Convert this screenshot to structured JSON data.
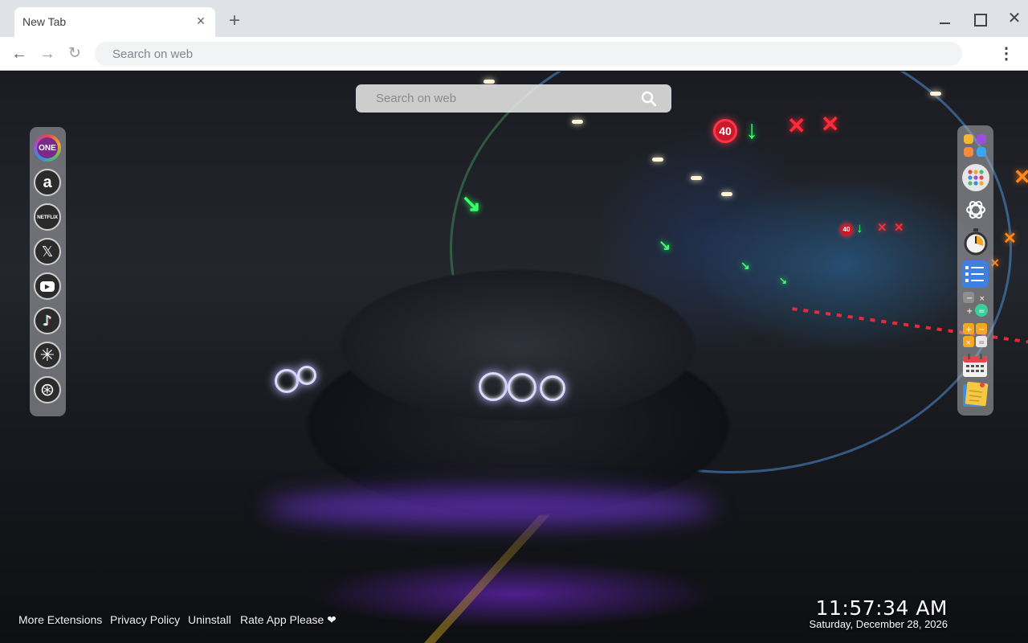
{
  "browser": {
    "tab_title": "New Tab",
    "tab_close_glyph": "×",
    "new_tab_glyph": "+",
    "close_glyph": "✕",
    "back_glyph": "←",
    "forward_glyph": "→",
    "reload_glyph": "↻",
    "menu_glyph": "⋮",
    "address_placeholder": "Search on web"
  },
  "search": {
    "placeholder": "Search on web"
  },
  "wallpaper": {
    "speed_sign": "40",
    "speed_sign_small": "40",
    "arrow_down": "↓",
    "arrow_diag": "↘",
    "cross": "✕"
  },
  "left_dock": {
    "items": [
      {
        "name": "one-icon",
        "glyph": "ONE",
        "color": "#7a2a8a"
      },
      {
        "name": "amazon-icon",
        "glyph": "a"
      },
      {
        "name": "netflix-icon",
        "glyph": "NETFLIX"
      },
      {
        "name": "x-icon",
        "glyph": "𝕏"
      },
      {
        "name": "youtube-icon",
        "glyph": "▶"
      },
      {
        "name": "tiktok-icon",
        "glyph": "♪"
      },
      {
        "name": "perplexity-icon",
        "glyph": "✳"
      },
      {
        "name": "chatgpt-icon",
        "glyph": "⊛"
      }
    ]
  },
  "right_dock": {
    "items": [
      {
        "name": "apps-icon"
      },
      {
        "name": "grid-menu-icon"
      },
      {
        "name": "chatgpt-icon"
      },
      {
        "name": "stopwatch-icon"
      },
      {
        "name": "todo-list-icon"
      },
      {
        "name": "calculator-icon"
      },
      {
        "name": "calculator-orange-icon"
      },
      {
        "name": "calendar-icon"
      },
      {
        "name": "sticky-note-icon"
      }
    ]
  },
  "footer": {
    "more_extensions": "More Extensions",
    "privacy_policy": "Privacy Policy",
    "uninstall": "Uninstall",
    "rate_app": "Rate App Please ❤"
  },
  "clock": {
    "time": "11:57:34 AM",
    "date": "Saturday, December 28, 2026"
  },
  "colors": {
    "accent_green": "#3dff6a",
    "accent_red": "#ff2a3a",
    "underglow_purple": "#8a3cff"
  }
}
